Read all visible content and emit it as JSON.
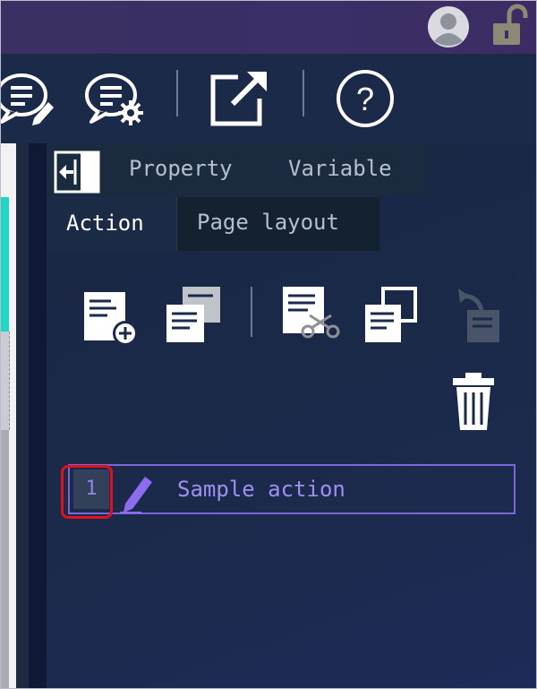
{
  "titlebar": {
    "icons": [
      "user-avatar-icon",
      "unlocked-padlock-icon"
    ]
  },
  "toolbar": {
    "icons": [
      "comment-edit-icon",
      "comment-settings-icon",
      "open-external-icon",
      "help-icon"
    ],
    "help_label": "?"
  },
  "panel": {
    "tabs_row1": {
      "property_label": "Property",
      "variable_label": "Variable"
    },
    "tabs_row2": {
      "action_label": "Action",
      "page_layout_label": "Page layout",
      "active": "Action"
    },
    "action_toolbar_icons": [
      "add-action-icon",
      "duplicate-action-icon",
      "cut-action-icon",
      "copy-action-icon",
      "paste-action-icon",
      "delete-action-icon"
    ],
    "actions": [
      {
        "number": "1",
        "name": "Sample action",
        "icon": "pen-icon"
      }
    ]
  },
  "colors": {
    "titlebar": "#3b2f63",
    "panel_bg": "#1b2a4a",
    "action_border": "#7a66d6",
    "highlight": "#e0101c",
    "accent_teal": "#22d6c6"
  }
}
